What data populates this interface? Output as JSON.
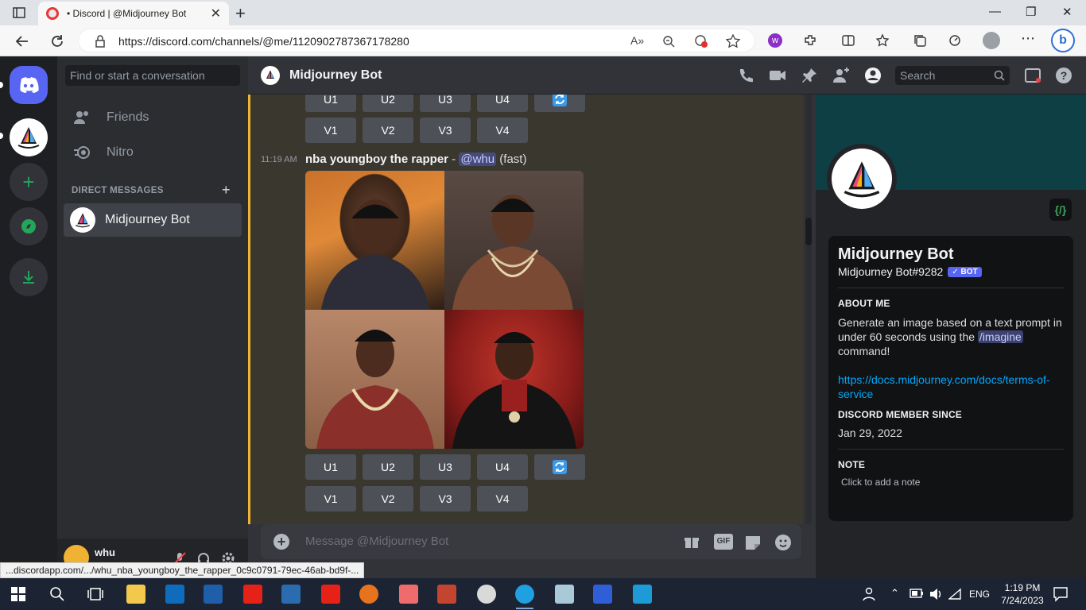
{
  "browser": {
    "tab_title": "• Discord | @Midjourney Bot",
    "url": "https://discord.com/channels/@me/1120902787367178280",
    "status_url": "...discordapp.com/.../whu_nba_youngboy_the_rapper_0c9c0791-79ec-46ab-bd9f-..."
  },
  "sidebar": {
    "search_placeholder": "Find or start a conversation",
    "nav": [
      {
        "label": "Friends"
      },
      {
        "label": "Nitro"
      }
    ],
    "dm_header": "DIRECT MESSAGES",
    "dms": [
      {
        "label": "Midjourney Bot"
      }
    ]
  },
  "user": {
    "name": "whu"
  },
  "channel": {
    "title": "Midjourney Bot",
    "search_placeholder": "Search"
  },
  "chat": {
    "top_upscale": [
      "U1",
      "U2",
      "U3",
      "U4"
    ],
    "top_variation": [
      "V1",
      "V2",
      "V3",
      "V4"
    ],
    "message": {
      "time": "11:19 AM",
      "prompt": "nba youngboy the rapper",
      "separator": " - ",
      "mention": "@whu",
      "mode": " (fast)"
    },
    "upscale": [
      "U1",
      "U2",
      "U3",
      "U4"
    ],
    "variation": [
      "V1",
      "V2",
      "V3",
      "V4"
    ],
    "composer_placeholder": "Message @Midjourney Bot"
  },
  "profile": {
    "name": "Midjourney Bot",
    "tag": "Midjourney Bot#9282",
    "badge": "✓ BOT",
    "dev_badge": "{/}",
    "about_heading": "ABOUT ME",
    "about_1": "Generate an image based on a text prompt in under 60 seconds using the ",
    "about_cmd": "/imagine",
    "about_2": " command!",
    "link": "https://docs.midjourney.com/docs/terms-of-service",
    "since_heading": "DISCORD MEMBER SINCE",
    "since": "Jan 29, 2022",
    "note_heading": "NOTE",
    "note_placeholder": "Click to add a note"
  },
  "taskbar": {
    "time": "1:19 PM",
    "date": "7/24/2023",
    "lang": "ENG"
  },
  "colors": {
    "discord_blurple": "#5865f2",
    "highlight_bar": "#f0b232",
    "green": "#23a55a",
    "link": "#00a8fc"
  }
}
